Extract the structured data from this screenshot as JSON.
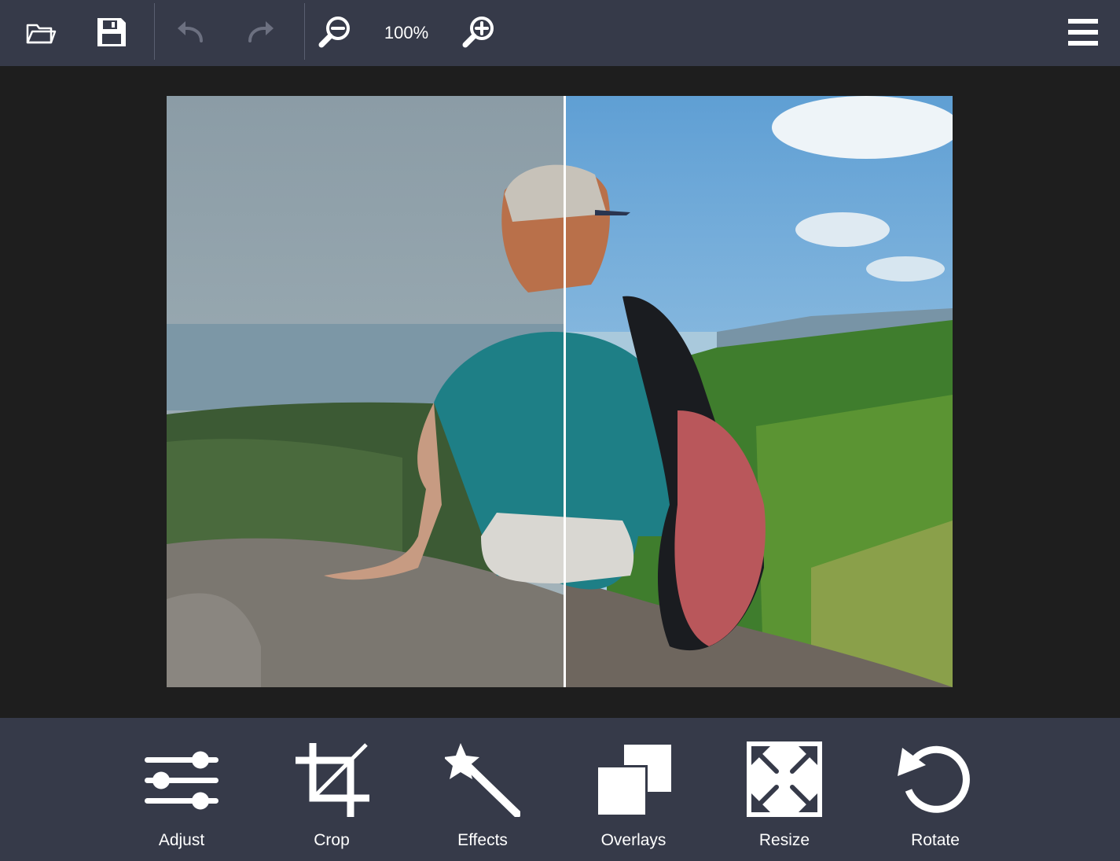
{
  "toolbar": {
    "zoom_level": "100%",
    "icons": {
      "open": "folder-open-icon",
      "save": "floppy-disk-icon",
      "undo": "undo-icon",
      "redo": "redo-icon",
      "zoom_out": "zoom-out-icon",
      "zoom_in": "zoom-in-icon",
      "menu": "hamburger-menu-icon"
    }
  },
  "tools": [
    {
      "label": "Adjust",
      "icon": "sliders-icon"
    },
    {
      "label": "Crop",
      "icon": "crop-icon"
    },
    {
      "label": "Effects",
      "icon": "magic-wand-icon"
    },
    {
      "label": "Overlays",
      "icon": "overlays-icon"
    },
    {
      "label": "Resize",
      "icon": "resize-icon"
    },
    {
      "label": "Rotate",
      "icon": "rotate-icon"
    }
  ],
  "colors": {
    "bar_background": "#363a49",
    "canvas_background": "#1e1e1e",
    "icon_active": "#ffffff",
    "icon_disabled": "#6c7080"
  }
}
